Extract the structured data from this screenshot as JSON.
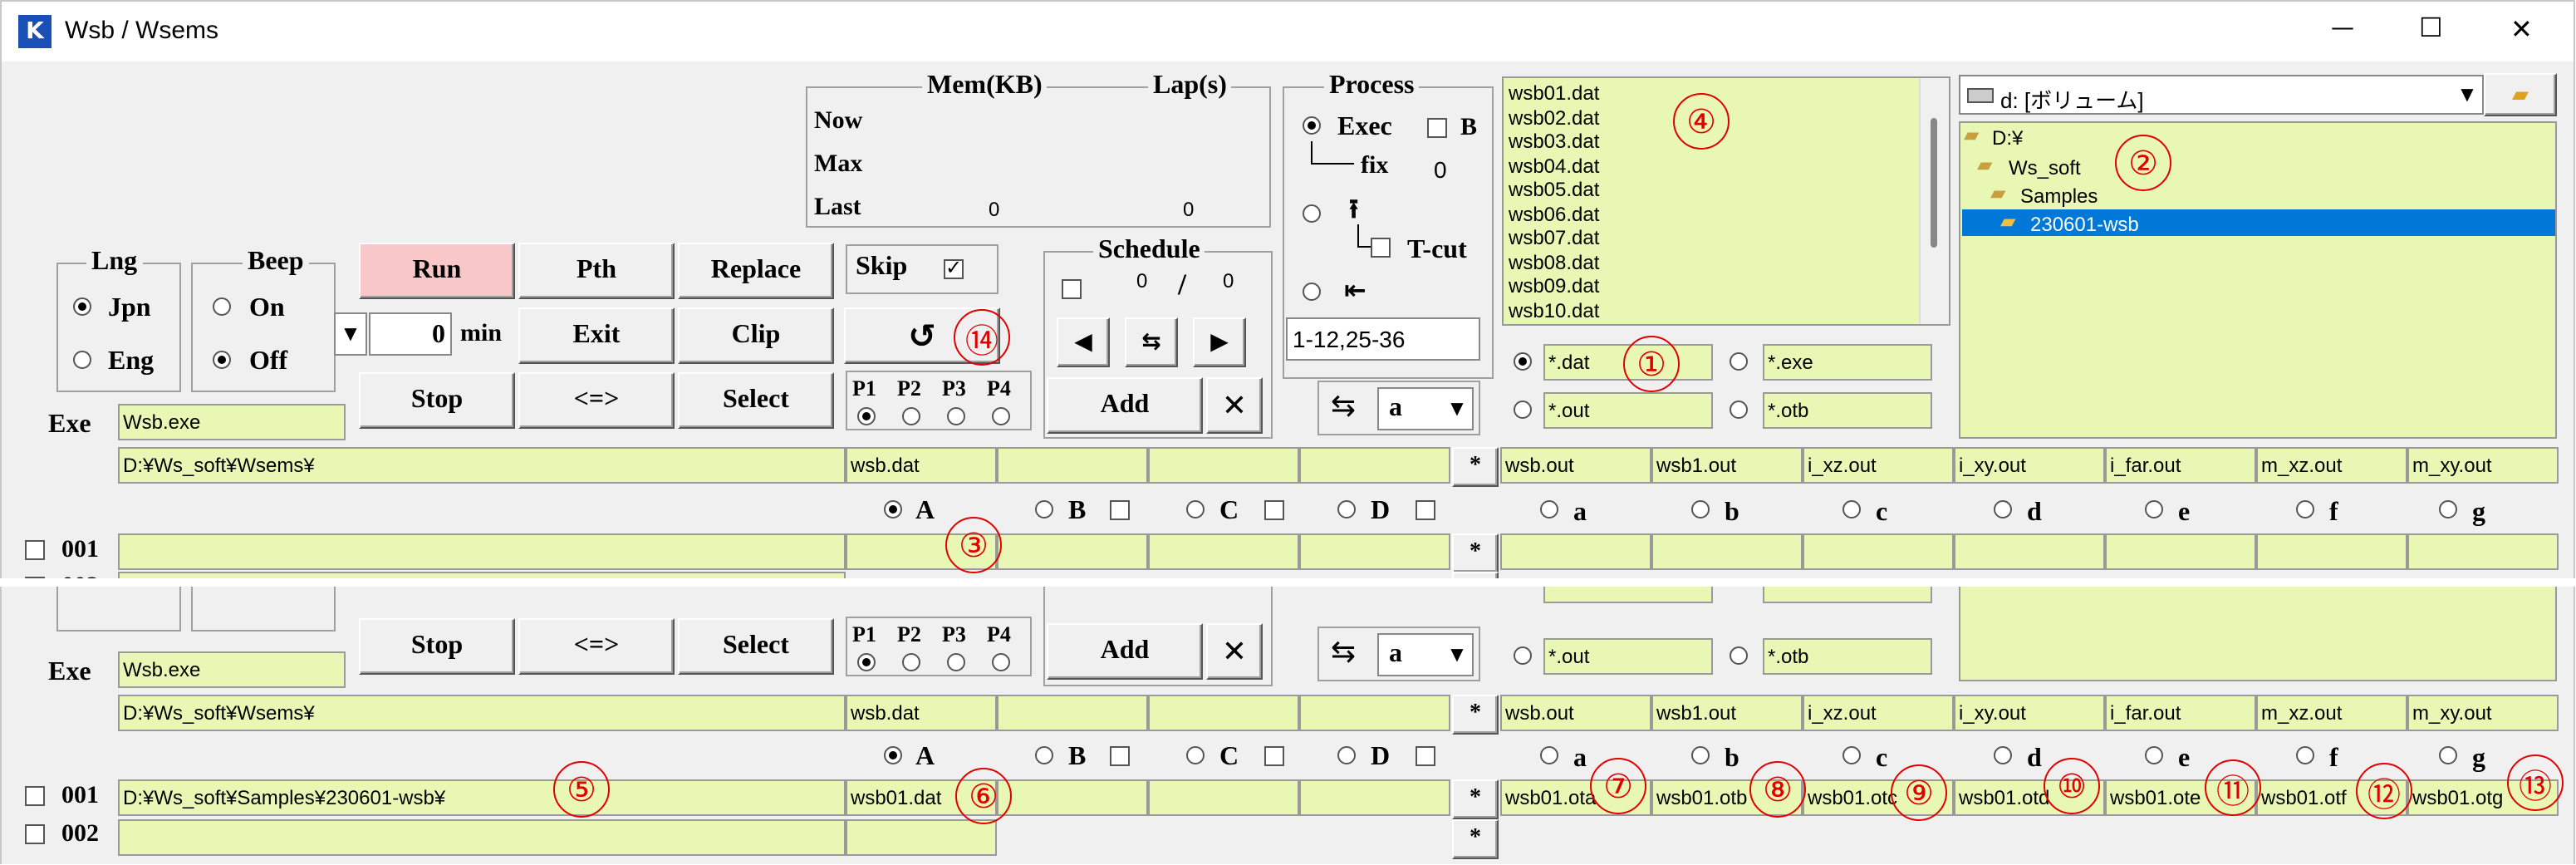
{
  "window": {
    "title": "Wsb / Wsems",
    "min": "—",
    "max": "☐",
    "close": "✕"
  },
  "mem": {
    "label": "Mem(KB)",
    "lap": "Lap(s)",
    "now": "Now",
    "max": "Max",
    "last": "Last",
    "last_mem": "0",
    "last_lap": "0"
  },
  "process": {
    "label": "Process",
    "exec": "Exec",
    "b": "B",
    "fix": "fix",
    "fix_val": "0",
    "tcut": "T-cut",
    "range": "1-12,25-36"
  },
  "files": [
    "wsb01.dat",
    "wsb02.dat",
    "wsb03.dat",
    "wsb04.dat",
    "wsb05.dat",
    "wsb06.dat",
    "wsb07.dat",
    "wsb08.dat",
    "wsb09.dat",
    "wsb10.dat"
  ],
  "filters": {
    "dat": "*.dat",
    "exe": "*.exe",
    "out": "*.out",
    "otb": "*.otb"
  },
  "drive": "d: [ボリューム]",
  "tree": [
    "D:¥",
    "Ws_soft",
    "Samples",
    "230601-wsb"
  ],
  "lng": {
    "label": "Lng",
    "jpn": "Jpn",
    "eng": "Eng"
  },
  "beep": {
    "label": "Beep",
    "on": "On",
    "off": "Off"
  },
  "buttons": {
    "run": "Run",
    "pth": "Pth",
    "replace": "Replace",
    "exit": "Exit",
    "clip": "Clip",
    "stop": "Stop",
    "swap": "<=>",
    "select": "Select",
    "add": "Add",
    "del": "✕",
    "refresh": "↺"
  },
  "minutes": {
    "value": "0",
    "unit": "min"
  },
  "skip": "Skip",
  "priority": [
    "P1",
    "P2",
    "P3",
    "P4"
  ],
  "schedule": {
    "label": "Schedule",
    "done": "0",
    "slash": "/",
    "total": "0"
  },
  "sort_select": "a",
  "exe": {
    "label": "Exe",
    "value": "Wsb.exe"
  },
  "path_row": {
    "dir": "D:¥Ws_soft¥Wsems¥",
    "dat": "wsb.dat"
  },
  "star": "*",
  "outs": [
    "wsb.out",
    "wsb1.out",
    "i_xz.out",
    "i_xy.out",
    "i_far.out",
    "m_xz.out",
    "m_xy.out"
  ],
  "cols_upper": [
    "A",
    "B",
    "C",
    "D"
  ],
  "cols_lower": [
    "a",
    "b",
    "c",
    "d",
    "e",
    "f",
    "g"
  ],
  "rows": [
    "001",
    "002"
  ],
  "row1_lower": {
    "path": "D:¥Ws_soft¥Samples¥230601-wsb¥",
    "dat": "wsb01.dat",
    "outs": [
      "wsb01.ota",
      "wsb01.otb",
      "wsb01.otc",
      "wsb01.otd",
      "wsb01.ote",
      "wsb01.otf",
      "wsb01.otg"
    ]
  },
  "callouts": [
    "①",
    "②",
    "③",
    "④",
    "⑤",
    "⑥",
    "⑦",
    "⑧",
    "⑨",
    "⑩",
    "⑪",
    "⑫",
    "⑬",
    "⑭"
  ],
  "colors": {
    "field": "#e8f8b4",
    "run": "#f8c8c8",
    "select": "#0078d7",
    "callout": "#e00000",
    "panel": "#f0f0f0"
  }
}
